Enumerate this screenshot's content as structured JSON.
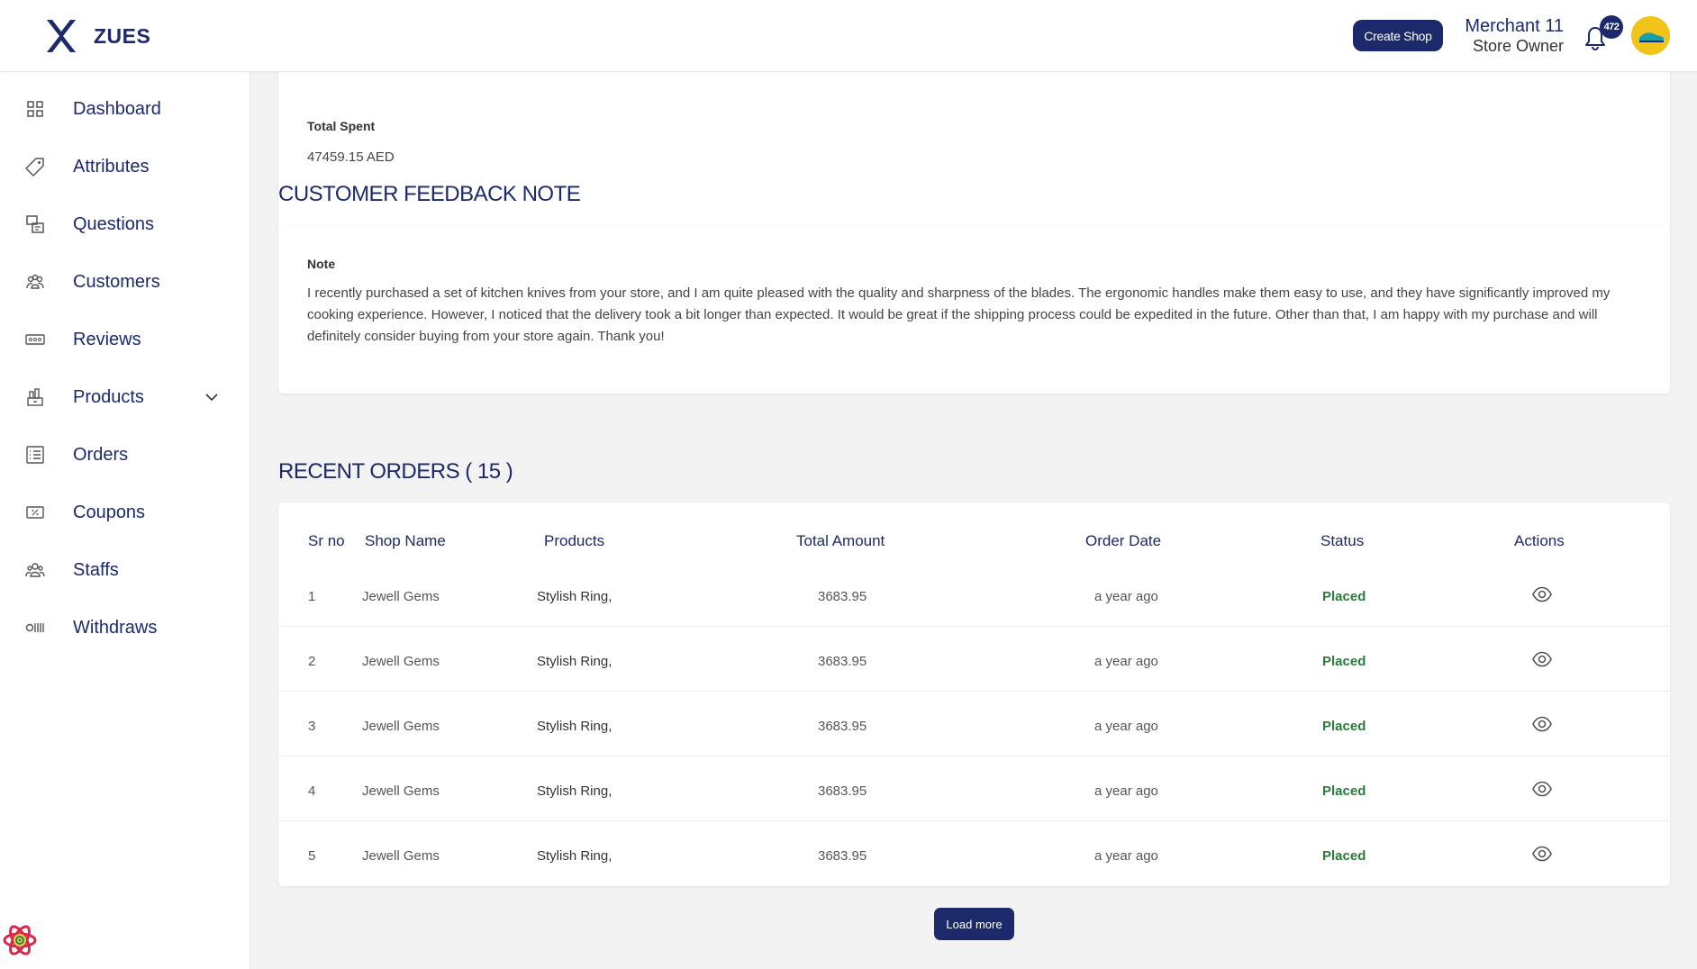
{
  "header": {
    "brand": "ZUES",
    "create_shop_label": "Create Shop",
    "user_name": "Merchant 11",
    "user_role": "Store Owner",
    "notification_count": "472"
  },
  "sidebar": {
    "items": [
      {
        "label": "Dashboard",
        "icon": "dashboard-icon"
      },
      {
        "label": "Attributes",
        "icon": "tag-icon"
      },
      {
        "label": "Questions",
        "icon": "questions-icon"
      },
      {
        "label": "Customers",
        "icon": "customers-icon"
      },
      {
        "label": "Reviews",
        "icon": "reviews-icon"
      },
      {
        "label": "Products",
        "icon": "products-icon"
      },
      {
        "label": "Orders",
        "icon": "orders-icon"
      },
      {
        "label": "Coupons",
        "icon": "coupons-icon"
      },
      {
        "label": "Staffs",
        "icon": "staffs-icon"
      },
      {
        "label": "Withdraws",
        "icon": "withdraws-icon"
      }
    ]
  },
  "spent": {
    "label": "Total Spent",
    "value": "47459.15 AED"
  },
  "feedback": {
    "title": "CUSTOMER FEEDBACK NOTE",
    "note_label": "Note",
    "note_text": "I recently purchased a set of kitchen knives from your store, and I am quite pleased with the quality and sharpness of the blades. The ergonomic handles make them easy to use, and they have significantly improved my cooking experience. However, I noticed that the delivery took a bit longer than expected. It would be great if the shipping process could be expedited in the future. Other than that, I am happy with my purchase and will definitely consider buying from your store again. Thank you!"
  },
  "orders": {
    "title": "RECENT ORDERS ( 15 )",
    "columns": [
      "Sr no",
      "Shop Name",
      "Products",
      "Total Amount",
      "Order Date",
      "Status",
      "Actions"
    ],
    "rows": [
      {
        "sr": "1",
        "shop": "Jewell Gems",
        "products": "Stylish Ring,",
        "amount": "3683.95",
        "date": "a year ago",
        "status": "Placed"
      },
      {
        "sr": "2",
        "shop": "Jewell Gems",
        "products": "Stylish Ring,",
        "amount": "3683.95",
        "date": "a year ago",
        "status": "Placed"
      },
      {
        "sr": "3",
        "shop": "Jewell Gems",
        "products": "Stylish Ring,",
        "amount": "3683.95",
        "date": "a year ago",
        "status": "Placed"
      },
      {
        "sr": "4",
        "shop": "Jewell Gems",
        "products": "Stylish Ring,",
        "amount": "3683.95",
        "date": "a year ago",
        "status": "Placed"
      },
      {
        "sr": "5",
        "shop": "Jewell Gems",
        "products": "Stylish Ring,",
        "amount": "3683.95",
        "date": "a year ago",
        "status": "Placed"
      }
    ],
    "load_more_label": "Load more"
  },
  "colors": {
    "primary": "#1c2a6b",
    "status_placed": "#2a7a3c",
    "avatar_bg": "#f2c318",
    "page_bg": "#f3f3f4"
  }
}
